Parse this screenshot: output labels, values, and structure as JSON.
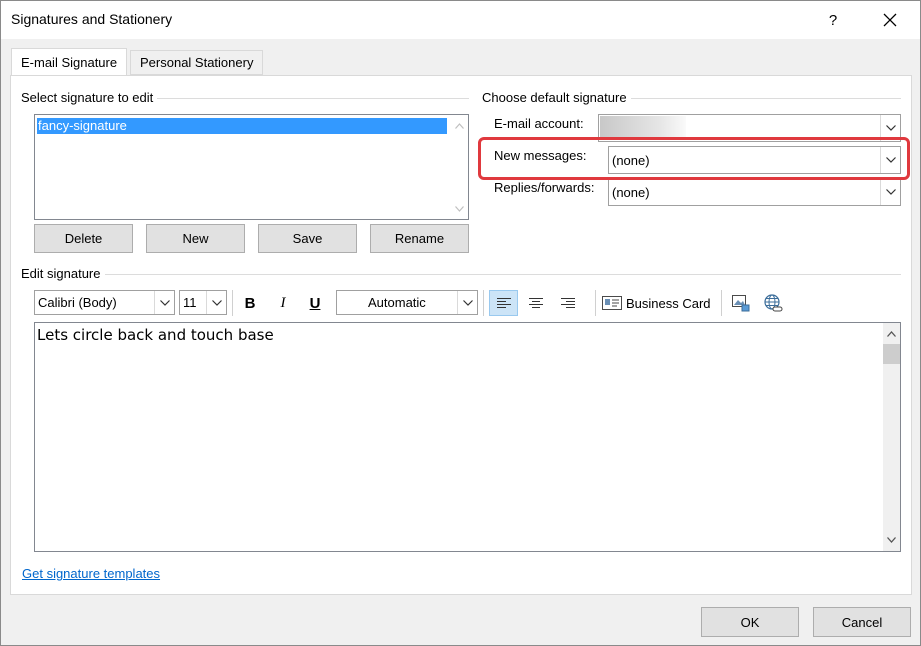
{
  "window": {
    "title": "Signatures and Stationery",
    "help_label": "?"
  },
  "tabs": [
    {
      "label": "E-mail Signature",
      "active": true
    },
    {
      "label": "Personal Stationery",
      "active": false
    }
  ],
  "select_signature": {
    "label": "Select signature to edit",
    "items": [
      "fancy-signature"
    ],
    "buttons": {
      "delete": "Delete",
      "new": "New",
      "save": "Save",
      "rename": "Rename"
    }
  },
  "default_signature": {
    "label": "Choose default signature",
    "email_account_label": "E-mail account:",
    "email_account_value": "",
    "new_messages_label": "New messages:",
    "new_messages_value": "(none)",
    "replies_label": "Replies/forwards:",
    "replies_value": "(none)"
  },
  "edit_signature": {
    "label": "Edit signature",
    "font": "Calibri (Body)",
    "size": "11",
    "bold": "B",
    "italic": "I",
    "underline": "U",
    "color": "Automatic",
    "business_card": "Business Card",
    "content": "Lets circle back and touch base"
  },
  "footer": {
    "link": "Get signature templates",
    "ok": "OK",
    "cancel": "Cancel"
  },
  "colors": {
    "selection": "#3399ff",
    "link": "#0066cc",
    "highlight": "#e0393e",
    "align_active": "#cce4f7"
  }
}
